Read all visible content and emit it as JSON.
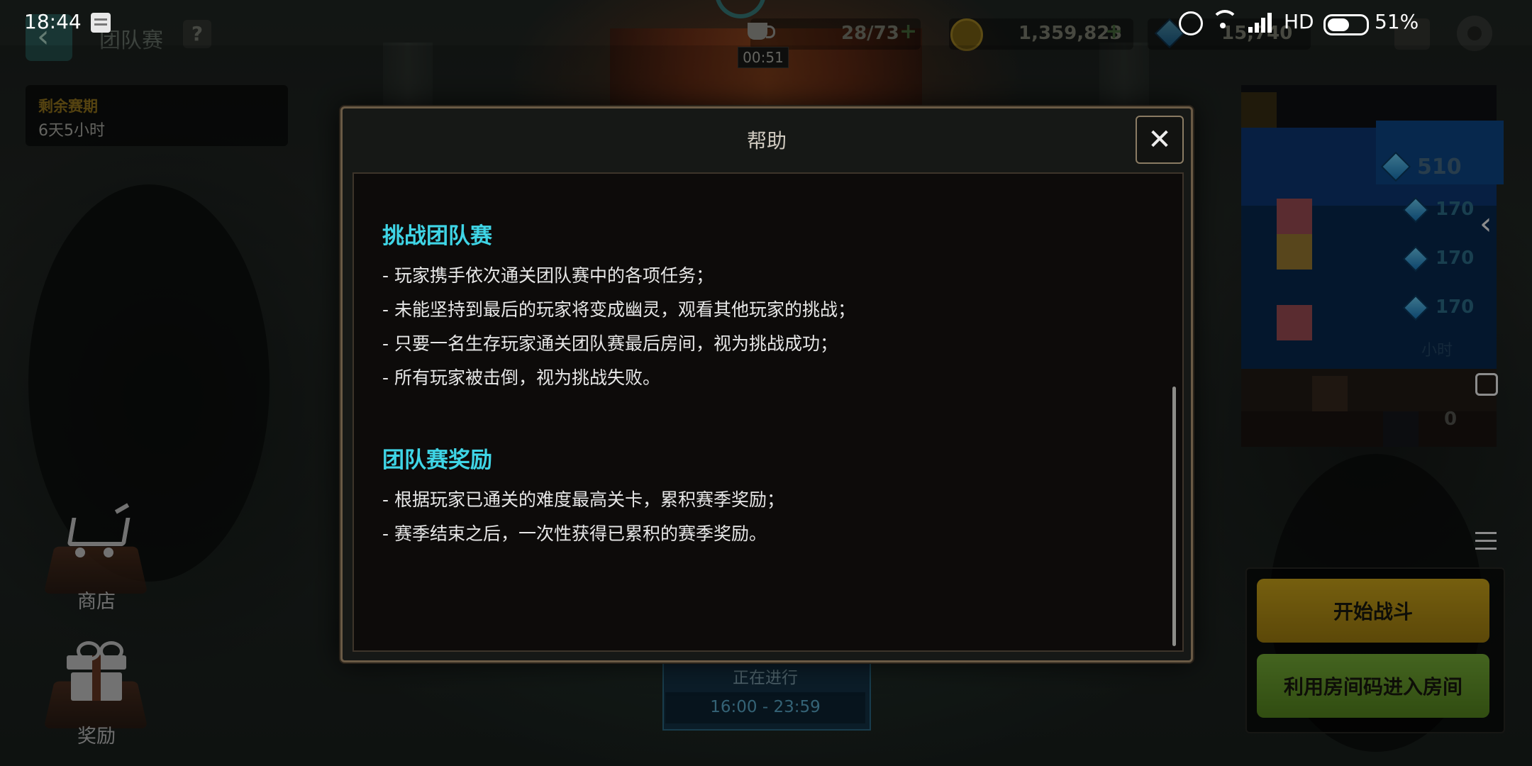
{
  "status_bar": {
    "time": "18:44",
    "network": "HD",
    "battery": "51%"
  },
  "top_bar": {
    "page_title": "团队赛",
    "help_label": "?",
    "stamina": "28/73",
    "stamina_timer": "00:51",
    "gold": "1,359,823",
    "gems": "15,740"
  },
  "season": {
    "label": "剩余赛期",
    "remaining": "6天5小时"
  },
  "left_menu": {
    "shop_label": "商店",
    "reward_label": "奖励"
  },
  "right_panel": {
    "main_cost": "510",
    "costs": [
      "170",
      "170",
      "170"
    ],
    "time_suffix": "小时",
    "count": "0"
  },
  "actions": {
    "start_battle": "开始战斗",
    "room_code": "利用房间码进入房间"
  },
  "schedule": {
    "status": "正在进行",
    "time_range": "16:00 - 23:59"
  },
  "modal": {
    "title": "帮助",
    "close_label": "✕",
    "sections": [
      {
        "title": "挑战团队赛",
        "lines": [
          "- 玩家携手依次通关团队赛中的各项任务；",
          "- 未能坚持到最后的玩家将变成幽灵，观看其他玩家的挑战；",
          "- 只要一名生存玩家通关团队赛最后房间，视为挑战成功；",
          "- 所有玩家被击倒，视为挑战失败。"
        ]
      },
      {
        "title": "团队赛奖励",
        "lines": [
          "- 根据玩家已通关的难度最高关卡，累积赛季奖励；",
          "- 赛季结束之后，一次性获得已累积的赛季奖励。"
        ]
      }
    ]
  },
  "colors": {
    "section_title": "#3fd5e6",
    "start_button": "#c9a216",
    "room_button": "#6fa52c"
  }
}
